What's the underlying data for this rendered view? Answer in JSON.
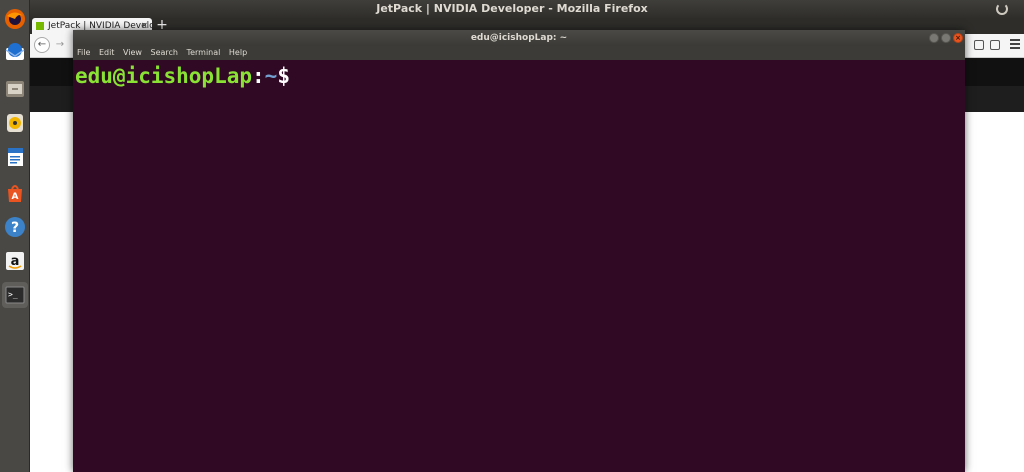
{
  "topbar": {
    "title": "JetPack | NVIDIA Developer - Mozilla Firefox"
  },
  "launcher": {
    "items": [
      {
        "name": "firefox-icon"
      },
      {
        "name": "thunderbird-icon"
      },
      {
        "name": "files-icon"
      },
      {
        "name": "rhythmbox-icon"
      },
      {
        "name": "writer-icon"
      },
      {
        "name": "software-center-icon"
      },
      {
        "name": "help-icon"
      },
      {
        "name": "amazon-icon"
      },
      {
        "name": "terminal-icon"
      }
    ]
  },
  "firefox": {
    "tab_label": "JetPack | NVIDIA Develo",
    "tab_close": "×",
    "new_tab": "+",
    "back": "←",
    "forward": "→"
  },
  "terminal": {
    "title": "edu@icishopLap: ~",
    "menu": [
      "File",
      "Edit",
      "View",
      "Search",
      "Terminal",
      "Help"
    ],
    "prompt_user": "edu@icishopLap",
    "prompt_sep": ":",
    "prompt_path": "~",
    "prompt_symbol": "$"
  }
}
